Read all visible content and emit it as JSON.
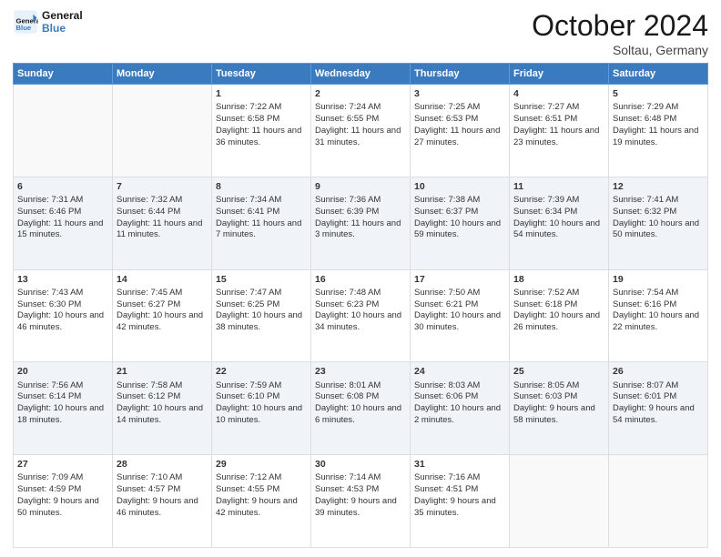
{
  "header": {
    "logo_line1": "General",
    "logo_line2": "Blue",
    "month": "October 2024",
    "location": "Soltau, Germany"
  },
  "weekdays": [
    "Sunday",
    "Monday",
    "Tuesday",
    "Wednesday",
    "Thursday",
    "Friday",
    "Saturday"
  ],
  "weeks": [
    [
      {
        "day": "",
        "sunrise": "",
        "sunset": "",
        "daylight": ""
      },
      {
        "day": "",
        "sunrise": "",
        "sunset": "",
        "daylight": ""
      },
      {
        "day": "1",
        "sunrise": "Sunrise: 7:22 AM",
        "sunset": "Sunset: 6:58 PM",
        "daylight": "Daylight: 11 hours and 36 minutes."
      },
      {
        "day": "2",
        "sunrise": "Sunrise: 7:24 AM",
        "sunset": "Sunset: 6:55 PM",
        "daylight": "Daylight: 11 hours and 31 minutes."
      },
      {
        "day": "3",
        "sunrise": "Sunrise: 7:25 AM",
        "sunset": "Sunset: 6:53 PM",
        "daylight": "Daylight: 11 hours and 27 minutes."
      },
      {
        "day": "4",
        "sunrise": "Sunrise: 7:27 AM",
        "sunset": "Sunset: 6:51 PM",
        "daylight": "Daylight: 11 hours and 23 minutes."
      },
      {
        "day": "5",
        "sunrise": "Sunrise: 7:29 AM",
        "sunset": "Sunset: 6:48 PM",
        "daylight": "Daylight: 11 hours and 19 minutes."
      }
    ],
    [
      {
        "day": "6",
        "sunrise": "Sunrise: 7:31 AM",
        "sunset": "Sunset: 6:46 PM",
        "daylight": "Daylight: 11 hours and 15 minutes."
      },
      {
        "day": "7",
        "sunrise": "Sunrise: 7:32 AM",
        "sunset": "Sunset: 6:44 PM",
        "daylight": "Daylight: 11 hours and 11 minutes."
      },
      {
        "day": "8",
        "sunrise": "Sunrise: 7:34 AM",
        "sunset": "Sunset: 6:41 PM",
        "daylight": "Daylight: 11 hours and 7 minutes."
      },
      {
        "day": "9",
        "sunrise": "Sunrise: 7:36 AM",
        "sunset": "Sunset: 6:39 PM",
        "daylight": "Daylight: 11 hours and 3 minutes."
      },
      {
        "day": "10",
        "sunrise": "Sunrise: 7:38 AM",
        "sunset": "Sunset: 6:37 PM",
        "daylight": "Daylight: 10 hours and 59 minutes."
      },
      {
        "day": "11",
        "sunrise": "Sunrise: 7:39 AM",
        "sunset": "Sunset: 6:34 PM",
        "daylight": "Daylight: 10 hours and 54 minutes."
      },
      {
        "day": "12",
        "sunrise": "Sunrise: 7:41 AM",
        "sunset": "Sunset: 6:32 PM",
        "daylight": "Daylight: 10 hours and 50 minutes."
      }
    ],
    [
      {
        "day": "13",
        "sunrise": "Sunrise: 7:43 AM",
        "sunset": "Sunset: 6:30 PM",
        "daylight": "Daylight: 10 hours and 46 minutes."
      },
      {
        "day": "14",
        "sunrise": "Sunrise: 7:45 AM",
        "sunset": "Sunset: 6:27 PM",
        "daylight": "Daylight: 10 hours and 42 minutes."
      },
      {
        "day": "15",
        "sunrise": "Sunrise: 7:47 AM",
        "sunset": "Sunset: 6:25 PM",
        "daylight": "Daylight: 10 hours and 38 minutes."
      },
      {
        "day": "16",
        "sunrise": "Sunrise: 7:48 AM",
        "sunset": "Sunset: 6:23 PM",
        "daylight": "Daylight: 10 hours and 34 minutes."
      },
      {
        "day": "17",
        "sunrise": "Sunrise: 7:50 AM",
        "sunset": "Sunset: 6:21 PM",
        "daylight": "Daylight: 10 hours and 30 minutes."
      },
      {
        "day": "18",
        "sunrise": "Sunrise: 7:52 AM",
        "sunset": "Sunset: 6:18 PM",
        "daylight": "Daylight: 10 hours and 26 minutes."
      },
      {
        "day": "19",
        "sunrise": "Sunrise: 7:54 AM",
        "sunset": "Sunset: 6:16 PM",
        "daylight": "Daylight: 10 hours and 22 minutes."
      }
    ],
    [
      {
        "day": "20",
        "sunrise": "Sunrise: 7:56 AM",
        "sunset": "Sunset: 6:14 PM",
        "daylight": "Daylight: 10 hours and 18 minutes."
      },
      {
        "day": "21",
        "sunrise": "Sunrise: 7:58 AM",
        "sunset": "Sunset: 6:12 PM",
        "daylight": "Daylight: 10 hours and 14 minutes."
      },
      {
        "day": "22",
        "sunrise": "Sunrise: 7:59 AM",
        "sunset": "Sunset: 6:10 PM",
        "daylight": "Daylight: 10 hours and 10 minutes."
      },
      {
        "day": "23",
        "sunrise": "Sunrise: 8:01 AM",
        "sunset": "Sunset: 6:08 PM",
        "daylight": "Daylight: 10 hours and 6 minutes."
      },
      {
        "day": "24",
        "sunrise": "Sunrise: 8:03 AM",
        "sunset": "Sunset: 6:06 PM",
        "daylight": "Daylight: 10 hours and 2 minutes."
      },
      {
        "day": "25",
        "sunrise": "Sunrise: 8:05 AM",
        "sunset": "Sunset: 6:03 PM",
        "daylight": "Daylight: 9 hours and 58 minutes."
      },
      {
        "day": "26",
        "sunrise": "Sunrise: 8:07 AM",
        "sunset": "Sunset: 6:01 PM",
        "daylight": "Daylight: 9 hours and 54 minutes."
      }
    ],
    [
      {
        "day": "27",
        "sunrise": "Sunrise: 7:09 AM",
        "sunset": "Sunset: 4:59 PM",
        "daylight": "Daylight: 9 hours and 50 minutes."
      },
      {
        "day": "28",
        "sunrise": "Sunrise: 7:10 AM",
        "sunset": "Sunset: 4:57 PM",
        "daylight": "Daylight: 9 hours and 46 minutes."
      },
      {
        "day": "29",
        "sunrise": "Sunrise: 7:12 AM",
        "sunset": "Sunset: 4:55 PM",
        "daylight": "Daylight: 9 hours and 42 minutes."
      },
      {
        "day": "30",
        "sunrise": "Sunrise: 7:14 AM",
        "sunset": "Sunset: 4:53 PM",
        "daylight": "Daylight: 9 hours and 39 minutes."
      },
      {
        "day": "31",
        "sunrise": "Sunrise: 7:16 AM",
        "sunset": "Sunset: 4:51 PM",
        "daylight": "Daylight: 9 hours and 35 minutes."
      },
      {
        "day": "",
        "sunrise": "",
        "sunset": "",
        "daylight": ""
      },
      {
        "day": "",
        "sunrise": "",
        "sunset": "",
        "daylight": ""
      }
    ]
  ]
}
